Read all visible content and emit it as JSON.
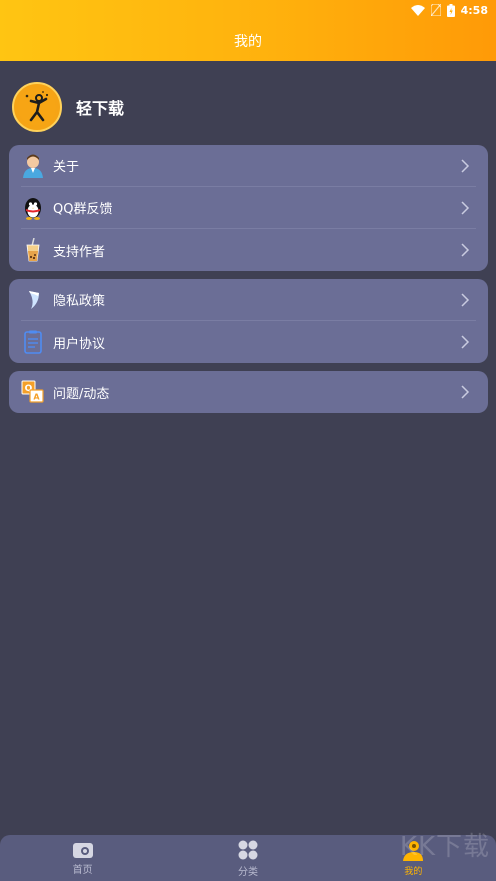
{
  "status": {
    "time": "4:58"
  },
  "header": {
    "title": "我的"
  },
  "profile": {
    "name": "轻下载"
  },
  "card1": {
    "items": [
      {
        "label": "关于"
      },
      {
        "label": "QQ群反馈"
      },
      {
        "label": "支持作者"
      }
    ]
  },
  "card2": {
    "items": [
      {
        "label": "隐私政策"
      },
      {
        "label": "用户协议"
      }
    ]
  },
  "card3": {
    "items": [
      {
        "label": "问题/动态"
      }
    ]
  },
  "tabbar": {
    "tabs": [
      {
        "label": "首页"
      },
      {
        "label": "分类"
      },
      {
        "label": "我的"
      }
    ]
  },
  "watermark": "KK下载",
  "colors": {
    "accent": "#ffb10d",
    "background": "#3f4053",
    "card": "#6b6e96"
  }
}
